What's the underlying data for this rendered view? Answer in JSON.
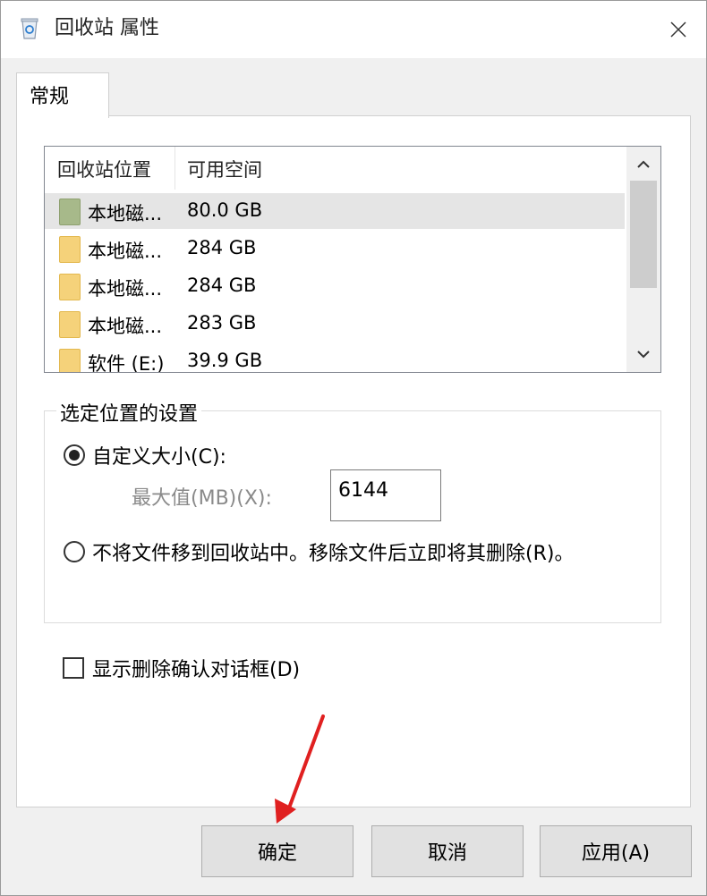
{
  "window": {
    "title": "回收站 属性",
    "icon": "recycle-bin-icon"
  },
  "tabs": [
    {
      "label": "常规"
    }
  ],
  "list": {
    "columns": [
      "回收站位置",
      "可用空间"
    ],
    "rows": [
      {
        "name": "本地磁...",
        "size": "80.0 GB",
        "icon": "drive-folder-green",
        "selected": true
      },
      {
        "name": "本地磁...",
        "size": "284 GB",
        "icon": "drive-folder-yellow",
        "selected": false
      },
      {
        "name": "本地磁...",
        "size": "284 GB",
        "icon": "drive-folder-yellow",
        "selected": false
      },
      {
        "name": "本地磁...",
        "size": "283 GB",
        "icon": "drive-folder-yellow",
        "selected": false
      },
      {
        "name": "软件 (E:)",
        "size": "39.9 GB",
        "icon": "drive-folder-yellow",
        "selected": false
      }
    ]
  },
  "settings": {
    "group_title": "选定位置的设置",
    "custom_size_label": "自定义大小(C):",
    "custom_size_selected": true,
    "max_label": "最大值(MB)(X):",
    "max_value": "6144",
    "no_move_label": "不将文件移到回收站中。移除文件后立即将其删除(R)。",
    "confirm_label": "显示删除确认对话框(D)",
    "confirm_checked": false
  },
  "buttons": {
    "ok": "确定",
    "cancel": "取消",
    "apply": "应用(A)"
  },
  "colors": {
    "annotation_arrow": "#e02020"
  }
}
